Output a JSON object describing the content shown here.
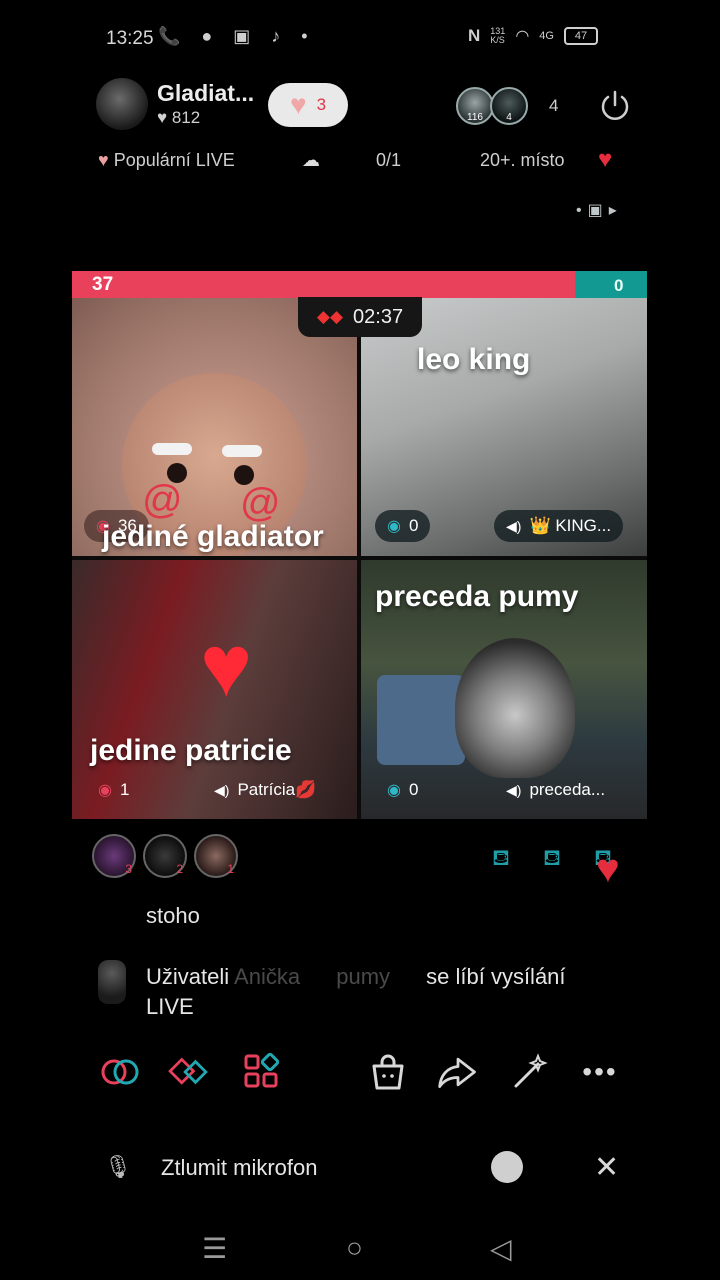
{
  "status": {
    "time": "13:25",
    "left_icons": "📞 ● ▣ ♪ •",
    "nfc": "N",
    "net_speed": "131\nK/S",
    "signal": "4G",
    "battery": "47"
  },
  "header": {
    "host_name": "Gladiat...",
    "host_likes": "♥ 812",
    "like_pill_count": "3",
    "viewer_badges": [
      "116",
      "4"
    ],
    "viewer_count": "4"
  },
  "info": {
    "popular": "Populární LIVE",
    "ratio": "0/1",
    "rank": "20+. místo"
  },
  "battle": {
    "score_left": "37",
    "score_right": "0",
    "timer": "02:37",
    "tiles": [
      {
        "name": "jediné gladiator",
        "chip": "36"
      },
      {
        "name": "leo king",
        "chip": "0",
        "tag": "👑 KING..."
      },
      {
        "name": "jedine patricie",
        "chip": "1",
        "tag": "Patrícia💋"
      },
      {
        "name": "preceda pumy",
        "chip": "0",
        "tag": "preceda..."
      }
    ]
  },
  "audience": {
    "ranks": [
      "3",
      "2",
      "1"
    ]
  },
  "comments": {
    "c1": "stoho",
    "c2_prefix": "Uživateli",
    "c2_user": "Anička",
    "c2_user2": "pumy",
    "c2_text": "se líbí vysílání",
    "c2_line2": "LIVE"
  },
  "mic": {
    "label": "Ztlumit mikrofon"
  },
  "colors": {
    "accent_red": "#e9415c",
    "accent_teal": "#129a92"
  }
}
